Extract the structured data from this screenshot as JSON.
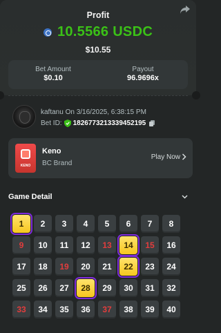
{
  "header": {
    "profit_label": "Profit",
    "amount": "10.5566 USDC",
    "fiat_value": "$10.55",
    "currency_icon": "usdc-icon",
    "share_icon": "share-icon"
  },
  "stats": [
    {
      "label": "Bet Amount",
      "value": "$0.10"
    },
    {
      "label": "Payout",
      "value": "96.9696x"
    }
  ],
  "player": {
    "name": "kaftanu",
    "date_text": "On 3/16/2025, 6:38:15 PM",
    "bet_id_label": "Bet ID:",
    "bet_id": "1826773213339452195"
  },
  "game": {
    "name": "Keno",
    "brand": "BC Brand",
    "play_label": "Play Now",
    "thumb_text": "KENO"
  },
  "detail": {
    "title": "Game Detail"
  },
  "grid": {
    "numbers": [
      1,
      2,
      3,
      4,
      5,
      6,
      7,
      8,
      9,
      10,
      11,
      12,
      13,
      14,
      15,
      16,
      17,
      18,
      19,
      20,
      21,
      22,
      23,
      24,
      25,
      26,
      27,
      28,
      29,
      30,
      31,
      32,
      33,
      34,
      35,
      36,
      37,
      38,
      39,
      40
    ],
    "drawn_red": [
      9,
      13,
      15,
      19,
      33,
      37
    ],
    "picked_hits": [
      1,
      14,
      22,
      28
    ]
  },
  "colors": {
    "profit_green": "#3bc117",
    "hit_yellow": "#f7c61f",
    "pick_outline": "#7f2bdb",
    "miss_red": "#e23d3d"
  }
}
